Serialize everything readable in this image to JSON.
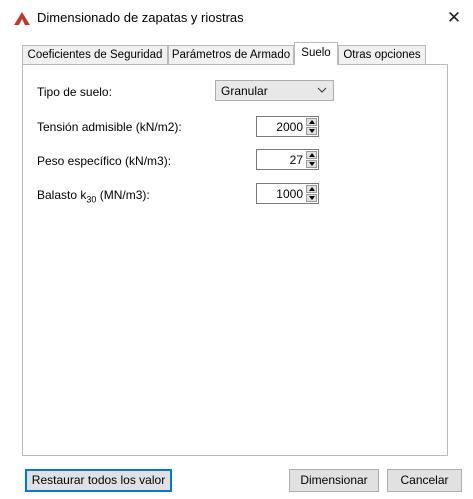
{
  "window": {
    "title": "Dimensionado de zapatas y riostras",
    "close_glyph": "✕",
    "icon": "app-logo-icon",
    "accent_color": "#c0392b"
  },
  "tabs": [
    {
      "label": "Coeficientes de Seguridad",
      "active": false
    },
    {
      "label": "Parámetros de Armado",
      "active": false
    },
    {
      "label": "Suelo",
      "active": true
    },
    {
      "label": "Otras opciones",
      "active": false
    }
  ],
  "suelo": {
    "tipo_label": "Tipo de suelo:",
    "tipo_value": "Granular",
    "tension_label": "Tensión admisible (kN/m2):",
    "tension_value": "2000",
    "peso_label": "Peso específico (kN/m3):",
    "peso_value": "27",
    "balasto_label_pre": "Balasto k",
    "balasto_label_sub": "30",
    "balasto_label_post": " (MN/m3):",
    "balasto_value": "1000"
  },
  "buttons": {
    "restore": "Restaurar todos los valor",
    "dimension": "Dimensionar",
    "cancel": "Cancelar"
  }
}
